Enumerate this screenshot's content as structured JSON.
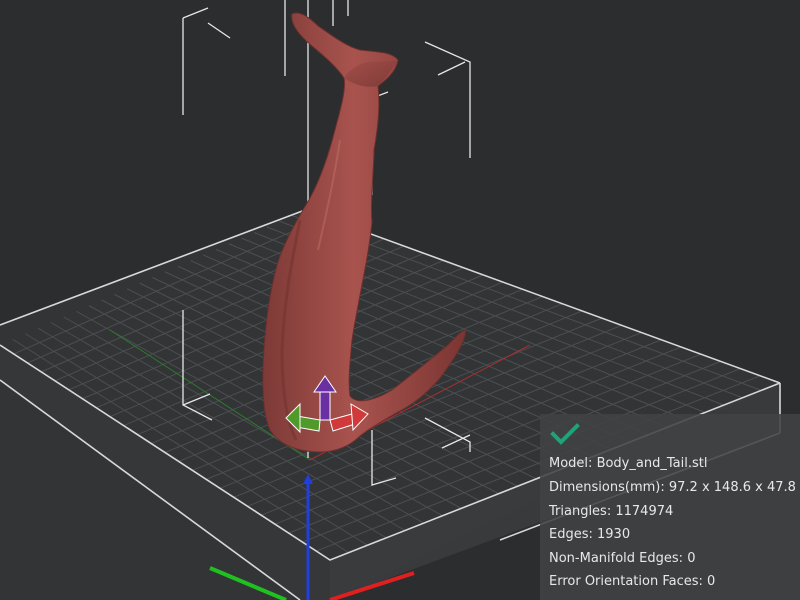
{
  "info": {
    "status_icon": "checkmark-icon",
    "status_color": "#1fa37a",
    "model_label": "Model:",
    "model_value": "Body_and_Tail.stl",
    "dimensions_label": "Dimensions(mm):",
    "dimensions_value": "97.2 x 148.6 x 47.8",
    "triangles_label": "Triangles:",
    "triangles_value": "1174974",
    "edges_label": "Edges:",
    "edges_value": "1930",
    "nonmanifold_label": "Non-Manifold Edges:",
    "nonmanifold_value": "0",
    "error_orientation_label": "Error Orientation Faces:",
    "error_orientation_value": "0"
  },
  "colors": {
    "background": "#2b2d2f",
    "model": "#9a4a46",
    "axis_x": "#e02020",
    "axis_y": "#20c020",
    "axis_z": "#1f3fe0",
    "gizmo_up": "#6a2fa3",
    "gizmo_left": "#4f9a2a",
    "gizmo_right": "#d03a3a"
  }
}
